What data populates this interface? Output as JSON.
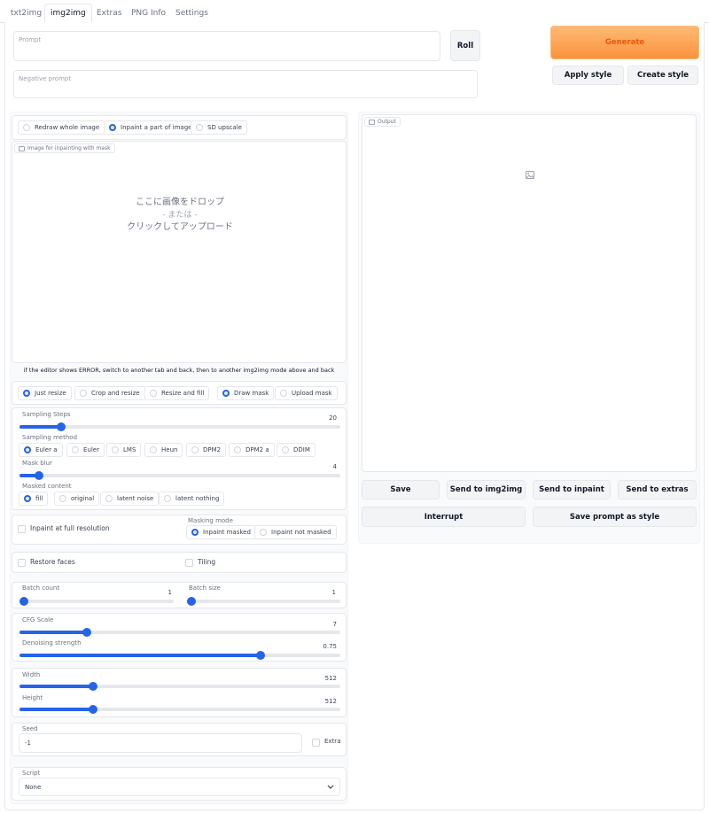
{
  "tabs": [
    "txt2img",
    "img2img",
    "Extras",
    "PNG Info",
    "Settings"
  ],
  "prompt": {
    "placeholder": "Prompt",
    "negative_placeholder": "Negative prompt"
  },
  "buttons": {
    "roll": "Roll",
    "generate": "Generate",
    "apply_style": "Apply style",
    "create_style": "Create style",
    "save": "Save",
    "send_img2img": "Send to img2img",
    "send_inpaint": "Send to inpaint",
    "send_extras": "Send to extras",
    "interrupt": "Interrupt",
    "save_prompt_style": "Save prompt as style"
  },
  "mode": {
    "options": [
      "Redraw whole image",
      "Inpaint a part of image",
      "SD upscale"
    ],
    "selected": "Inpaint a part of image"
  },
  "image_input": {
    "label": "Image for inpainting with mask",
    "drop_line1": "ここに画像をドロップ",
    "drop_line2": "- または -",
    "drop_line3": "クリックしてアップロード"
  },
  "editor_hint": "if the editor shows ERROR, switch to another tab and back, then to another img2img mode above and back",
  "resize": {
    "options": [
      "Just resize",
      "Crop and resize",
      "Resize and fill"
    ],
    "selected": "Just resize"
  },
  "mask_source": {
    "options": [
      "Draw mask",
      "Upload mask"
    ],
    "selected": "Draw mask"
  },
  "sampling_steps": {
    "label": "Sampling Steps",
    "value": "20",
    "fraction": 0.13
  },
  "sampling_method": {
    "label": "Sampling method",
    "options": [
      "Euler a",
      "Euler",
      "LMS",
      "Heun",
      "DPM2",
      "DPM2 a",
      "DDIM"
    ],
    "selected": "Euler a"
  },
  "mask_blur": {
    "label": "Mask blur",
    "value": "4",
    "fraction": 0.06
  },
  "masked_content": {
    "label": "Masked content",
    "options": [
      "fill",
      "original",
      "latent noise",
      "latent nothing"
    ],
    "selected": "fill"
  },
  "inpaint_full_res": "Inpaint at full resolution",
  "masking_mode": {
    "label": "Masking mode",
    "options": [
      "Inpaint masked",
      "Inpaint not masked"
    ],
    "selected": "Inpaint masked"
  },
  "restore_faces": "Restore faces",
  "tiling": "Tiling",
  "batch_count": {
    "label": "Batch count",
    "value": "1",
    "fraction": 0.0
  },
  "batch_size": {
    "label": "Batch size",
    "value": "1",
    "fraction": 0.0
  },
  "cfg_scale": {
    "label": "CFG Scale",
    "value": "7",
    "fraction": 0.21
  },
  "denoising": {
    "label": "Denoising strength",
    "value": "0.75",
    "fraction": 0.75
  },
  "width": {
    "label": "Width",
    "value": "512",
    "fraction": 0.23
  },
  "height": {
    "label": "Height",
    "value": "512",
    "fraction": 0.23
  },
  "seed": {
    "label": "Seed",
    "value": "-1",
    "extra": "Extra"
  },
  "script": {
    "label": "Script",
    "value": "None"
  },
  "output": {
    "label": "Output"
  },
  "colors": {
    "accent": "#2563eb",
    "generate": "#fb923c"
  }
}
